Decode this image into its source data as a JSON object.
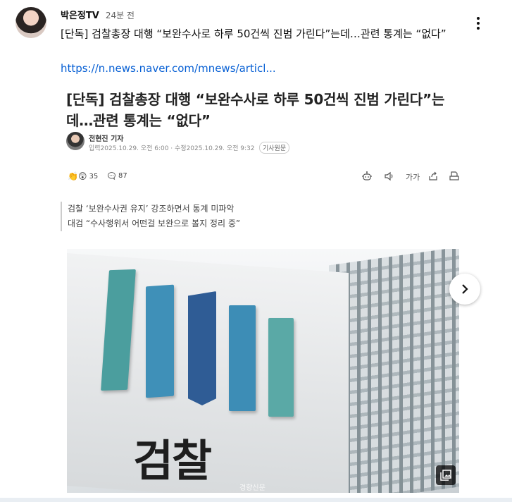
{
  "post": {
    "author": "박은정TV",
    "time": "24분 전",
    "text": "[단독] 검찰총장 대행 “보완수사로 하루 50건씩 진범 가린다”는데…관련 통계는 “없다”",
    "link": "https://n.news.naver.com/mnews/articl..."
  },
  "article": {
    "headline": "[단독] 검찰총장 대행 “보완수사로 하루 50건씩 진범 가린다”는데…관련 통계는 “없다”",
    "reporter": "전현진 기자",
    "meta": "입력2025.10.29. 오전 6:00 · 수정2025.10.29. 오전 9:32",
    "origin_badge": "기사원문",
    "reactions": {
      "likes": "35",
      "comments": "87"
    },
    "tools": {
      "font_size_label": "가가"
    },
    "summary": [
      "검찰 ‘보완수사권 유지’ 강조하면서 통계 미파악",
      "대검 “수사행위서 어떤걸 보완으로 볼지 정리 중”"
    ],
    "photo": {
      "sign_text": "검찰",
      "watermark": "경향신문"
    }
  },
  "colors": {
    "link": "#065fd4",
    "text": "#0f0f0f",
    "muted": "#606060"
  },
  "icons": [
    "more-vert-icon",
    "reaction-emoji-icon",
    "comment-icon",
    "robot-summary-icon",
    "speaker-icon",
    "font-size-icon",
    "share-icon",
    "print-icon",
    "gallery-icon",
    "chevron-right-icon"
  ]
}
